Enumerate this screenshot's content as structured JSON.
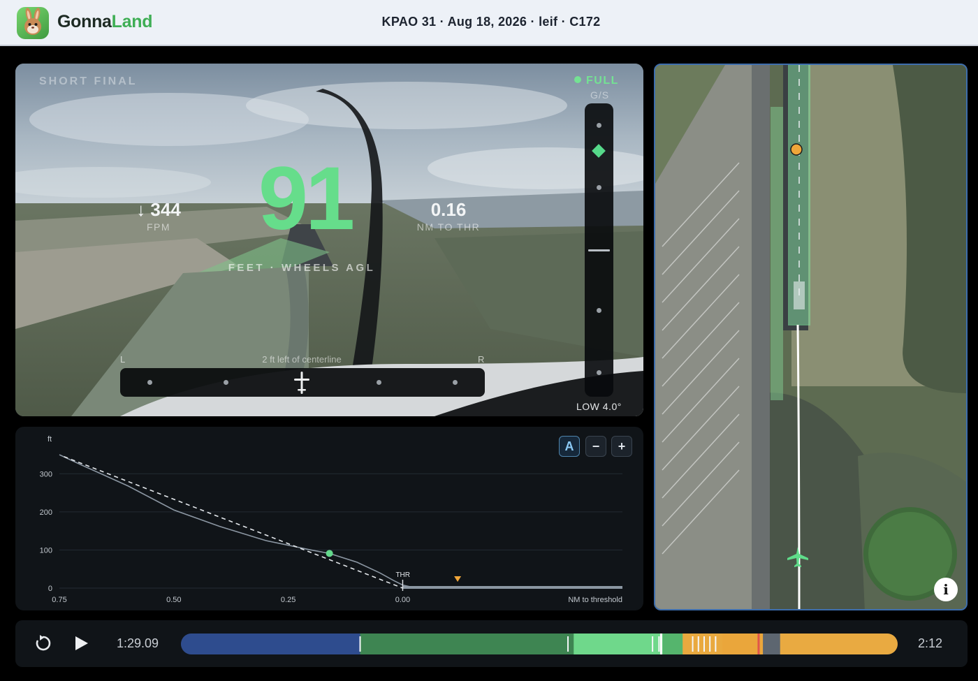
{
  "header": {
    "brand_part1": "Gonna",
    "brand_part2": "Land",
    "session": "KPAO 31 · Aug 18, 2026 · leif · C172"
  },
  "camera": {
    "phase": "SHORT FINAL",
    "status": "FULL",
    "status_color": "#74e293",
    "gs_label": "G/S",
    "gs_readout": "LOW 4.0°",
    "agl_value": "91",
    "agl_unit": "FEET · WHEELS AGL",
    "fpm_value": "↓ 344",
    "fpm_label": "FPM",
    "nm_value": "0.16",
    "nm_label": "NM TO THR",
    "lateral_left": "L",
    "lateral_right": "R",
    "lateral_text": "2 ft left of centerline"
  },
  "profile": {
    "controls": {
      "auto": "A",
      "zoom_out": "−",
      "zoom_in": "+"
    },
    "thr_label": "THR"
  },
  "chart_data": {
    "type": "line",
    "title": "",
    "xlabel": "NM to threshold",
    "ylabel": "ft",
    "xlim": [
      0.75,
      -0.48
    ],
    "ylim": [
      0,
      350
    ],
    "x_ticks": [
      "0.75",
      "0.50",
      "0.25",
      "0.00"
    ],
    "y_ticks": [
      "0",
      "100",
      "200",
      "300"
    ],
    "series": [
      {
        "style": "solid",
        "x": [
          0.75,
          0.7,
          0.6,
          0.5,
          0.4,
          0.3,
          0.2,
          0.16,
          0.1,
          0.05,
          0.02,
          0.0,
          -0.03,
          -0.48
        ],
        "y": [
          350,
          322,
          268,
          205,
          162,
          125,
          100,
          91,
          68,
          40,
          20,
          8,
          0,
          0
        ]
      },
      {
        "style": "dashed",
        "x": [
          0.74,
          0.0
        ],
        "y": [
          345,
          0
        ]
      }
    ],
    "current_point": {
      "x": 0.16,
      "y": 91
    },
    "marker_x": -0.12,
    "threshold_x": 0.0
  },
  "timeline": {
    "current_time": "1:29.09",
    "end_time": "2:12",
    "segments": [
      {
        "from": 0.0,
        "to": 0.25,
        "color": "#2e4c8e"
      },
      {
        "from": 0.25,
        "to": 0.548,
        "color": "#3e8552"
      },
      {
        "from": 0.548,
        "to": 0.672,
        "color": "#6fd88b"
      },
      {
        "from": 0.672,
        "to": 0.7,
        "color": "#55b56d"
      },
      {
        "from": 0.7,
        "to": 0.755,
        "color": "#e9a93f"
      },
      {
        "from": 0.755,
        "to": 0.812,
        "color": "#eaa63b"
      },
      {
        "from": 0.812,
        "to": 0.836,
        "color": "#5d6670"
      },
      {
        "from": 0.836,
        "to": 1.0,
        "color": "#e9aa41"
      }
    ],
    "ticks": [
      0.25,
      0.54,
      0.658,
      0.667,
      0.714,
      0.722,
      0.73,
      0.738,
      0.746
    ],
    "playhead": 0.67,
    "red_tick": 0.806
  }
}
